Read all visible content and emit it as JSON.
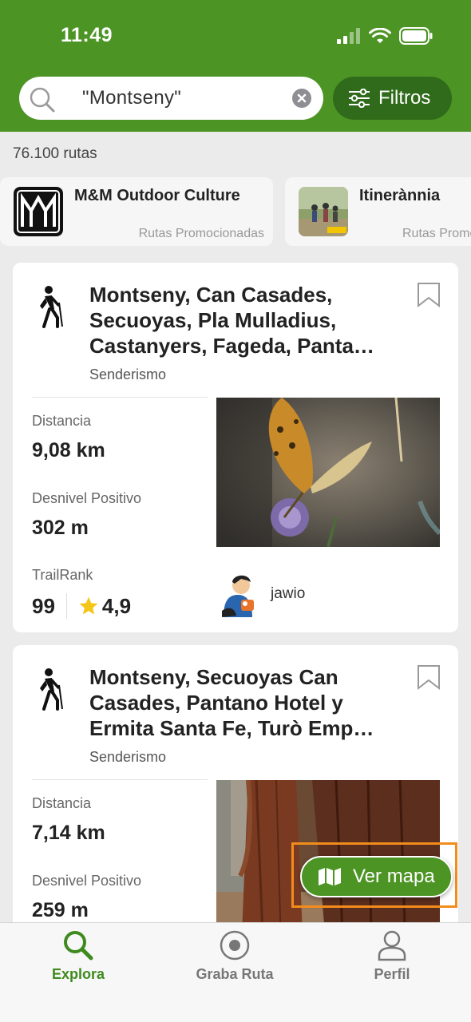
{
  "status_bar": {
    "time": "11:49"
  },
  "search": {
    "value": "\"Montseny\""
  },
  "filters": {
    "label": "Filtros"
  },
  "results": {
    "count_label": "76.100 rutas"
  },
  "promoted": [
    {
      "title": "M&M Outdoor Culture",
      "subtitle": "Rutas Promocionadas"
    },
    {
      "title": "Itinerànnia",
      "subtitle": "Rutas Promocionadas"
    }
  ],
  "routes": [
    {
      "title": "Montseny, Can Casades, Secuoyas, Pla Mulladius, Castanyers, Fageda, Panta…",
      "activity": "Senderismo",
      "distance_label": "Distancia",
      "distance": "9,08 km",
      "elevation_label": "Desnivel Positivo",
      "elevation": "302 m",
      "rank_label": "TrailRank",
      "rank": "99",
      "rating": "4,9",
      "author": "jawio"
    },
    {
      "title": "Montseny, Secuoyas Can Casades, Pantano Hotel y Ermita Santa Fe, Turò Emp…",
      "activity": "Senderismo",
      "distance_label": "Distancia",
      "distance": "7,14 km",
      "elevation_label": "Desnivel Positivo",
      "elevation": "259 m"
    }
  ],
  "map_button": {
    "label": "Ver mapa"
  },
  "tabbar": [
    {
      "label": "Explora",
      "icon": "search-icon",
      "active": true
    },
    {
      "label": "Graba Ruta",
      "icon": "record-icon",
      "active": false
    },
    {
      "label": "Perfil",
      "icon": "user-icon",
      "active": false
    }
  ],
  "colors": {
    "brand_green": "#4c9424",
    "dark_green": "#2f6b1a",
    "highlight_orange": "#f28c1c",
    "star": "#f5c518"
  }
}
